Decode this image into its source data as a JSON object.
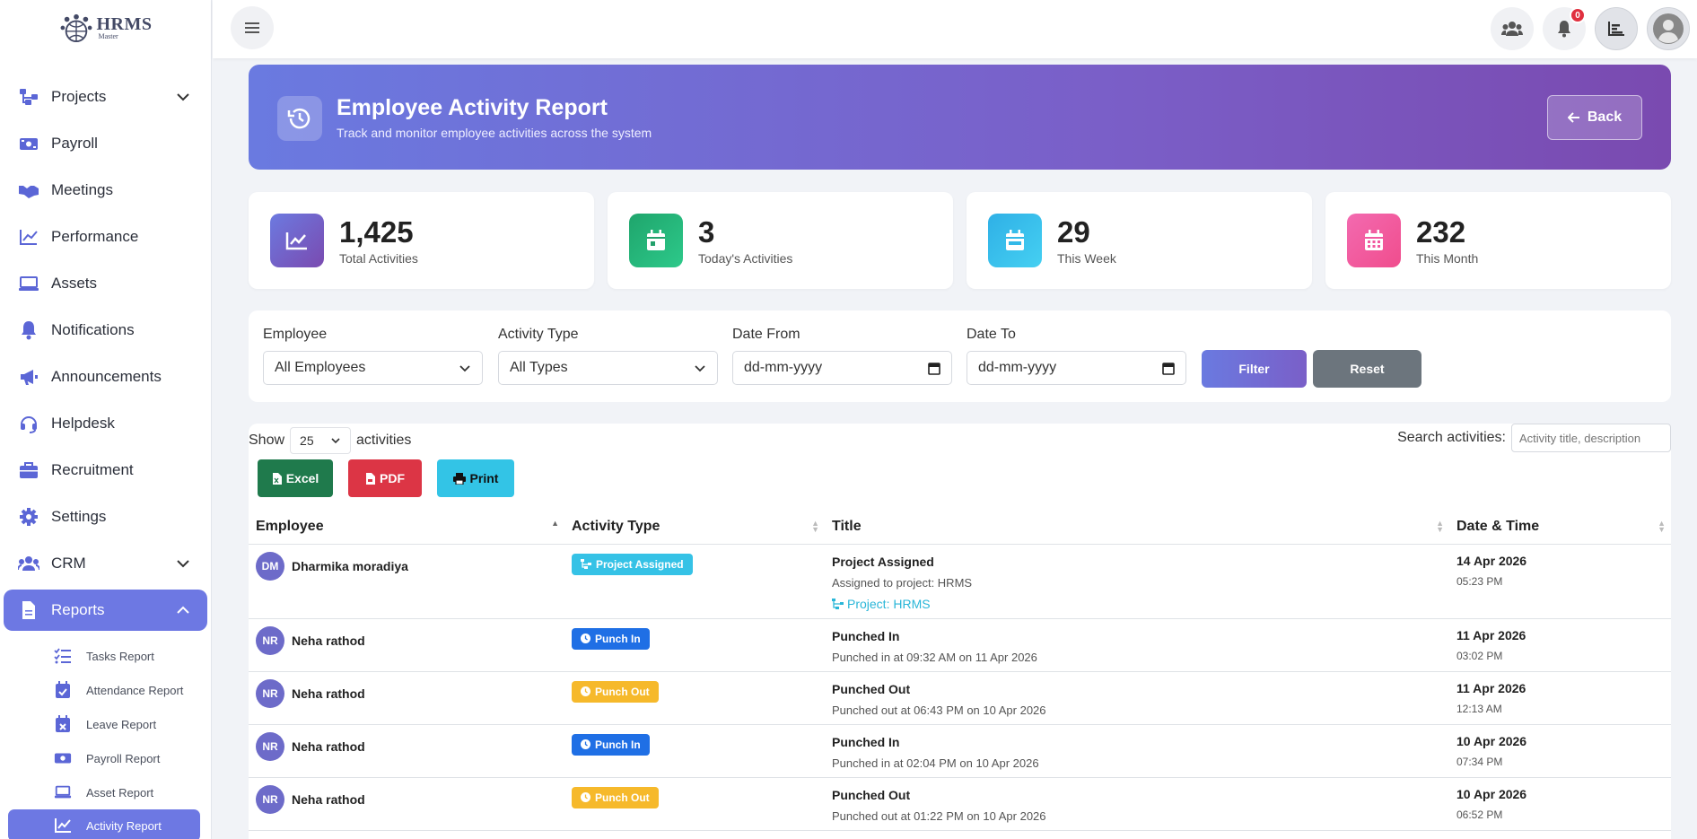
{
  "logo": {
    "line1": "HRMS",
    "line2": "Master"
  },
  "sidebar": {
    "items": [
      {
        "label": "Projects",
        "icon": "projects-icon",
        "chevron": "down"
      },
      {
        "label": "Payroll",
        "icon": "payroll-icon"
      },
      {
        "label": "Meetings",
        "icon": "meetings-icon"
      },
      {
        "label": "Performance",
        "icon": "performance-icon"
      },
      {
        "label": "Assets",
        "icon": "laptop-icon"
      },
      {
        "label": "Notifications",
        "icon": "bell-icon"
      },
      {
        "label": "Announcements",
        "icon": "megaphone-icon"
      },
      {
        "label": "Helpdesk",
        "icon": "headset-icon"
      },
      {
        "label": "Recruitment",
        "icon": "briefcase-icon"
      },
      {
        "label": "Settings",
        "icon": "gear-icon"
      },
      {
        "label": "CRM",
        "icon": "users-icon",
        "chevron": "down"
      },
      {
        "label": "Reports",
        "icon": "file-icon",
        "chevron": "up",
        "active": true
      }
    ],
    "subitems": [
      {
        "label": "Tasks Report",
        "icon": "list-check-icon"
      },
      {
        "label": "Attendance Report",
        "icon": "calendar-check-icon"
      },
      {
        "label": "Leave Report",
        "icon": "calendar-x-icon"
      },
      {
        "label": "Payroll Report",
        "icon": "money-icon"
      },
      {
        "label": "Asset Report",
        "icon": "laptop-icon"
      },
      {
        "label": "Activity Report",
        "icon": "chart-line-icon",
        "active": true
      }
    ]
  },
  "topbar": {
    "notification_count": "0"
  },
  "hero": {
    "title": "Employee Activity Report",
    "subtitle": "Track and monitor employee activities across the system",
    "back_label": "Back"
  },
  "stats": [
    {
      "value": "1,425",
      "label": "Total Activities",
      "color": "#6a5fc9"
    },
    {
      "value": "3",
      "label": "Today's Activities",
      "color": "#22a06b"
    },
    {
      "value": "29",
      "label": "This Week",
      "color": "#33b9e8"
    },
    {
      "value": "232",
      "label": "This Month",
      "color": "#f15aa0"
    }
  ],
  "filters": {
    "employee_label": "Employee",
    "employee_value": "All Employees",
    "type_label": "Activity Type",
    "type_value": "All Types",
    "from_label": "Date From",
    "from_value": "dd-mm-yyyy",
    "to_label": "Date To",
    "to_value": "dd-mm-yyyy",
    "filter_btn": "Filter",
    "reset_btn": "Reset"
  },
  "table_controls": {
    "show_label": "Show",
    "page_size": "25",
    "entries_label": "activities",
    "search_label": "Search activities:",
    "search_placeholder": "Activity title, description",
    "excel": "Excel",
    "pdf": "PDF",
    "print": "Print"
  },
  "table": {
    "headers": [
      "Employee",
      "Activity Type",
      "Title",
      "Date & Time"
    ],
    "rows": [
      {
        "initials": "DM",
        "employee": "Dharmika moradiya",
        "type": "Project Assigned",
        "type_color": "#35c2e6",
        "type_icon": "project-icon",
        "title": "Project Assigned",
        "desc": "Assigned to project: HRMS",
        "project": "Project: HRMS",
        "date": "14 Apr 2026",
        "time": "05:23 PM"
      },
      {
        "initials": "NR",
        "employee": "Neha rathod",
        "type": "Punch In",
        "type_color": "#1f6fe5",
        "type_icon": "clock-icon",
        "title": "Punched In",
        "desc": "Punched in at 09:32 AM on 11 Apr 2026",
        "project": "",
        "date": "11 Apr 2026",
        "time": "03:02 PM"
      },
      {
        "initials": "NR",
        "employee": "Neha rathod",
        "type": "Punch Out",
        "type_color": "#f6b92b",
        "type_icon": "clock-icon",
        "title": "Punched Out",
        "desc": "Punched out at 06:43 PM on 10 Apr 2026",
        "project": "",
        "date": "11 Apr 2026",
        "time": "12:13 AM"
      },
      {
        "initials": "NR",
        "employee": "Neha rathod",
        "type": "Punch In",
        "type_color": "#1f6fe5",
        "type_icon": "clock-icon",
        "title": "Punched In",
        "desc": "Punched in at 02:04 PM on 10 Apr 2026",
        "project": "",
        "date": "10 Apr 2026",
        "time": "07:34 PM"
      },
      {
        "initials": "NR",
        "employee": "Neha rathod",
        "type": "Punch Out",
        "type_color": "#f6b92b",
        "type_icon": "clock-icon",
        "title": "Punched Out",
        "desc": "Punched out at 01:22 PM on 10 Apr 2026",
        "project": "",
        "date": "10 Apr 2026",
        "time": "06:52 PM"
      }
    ]
  }
}
